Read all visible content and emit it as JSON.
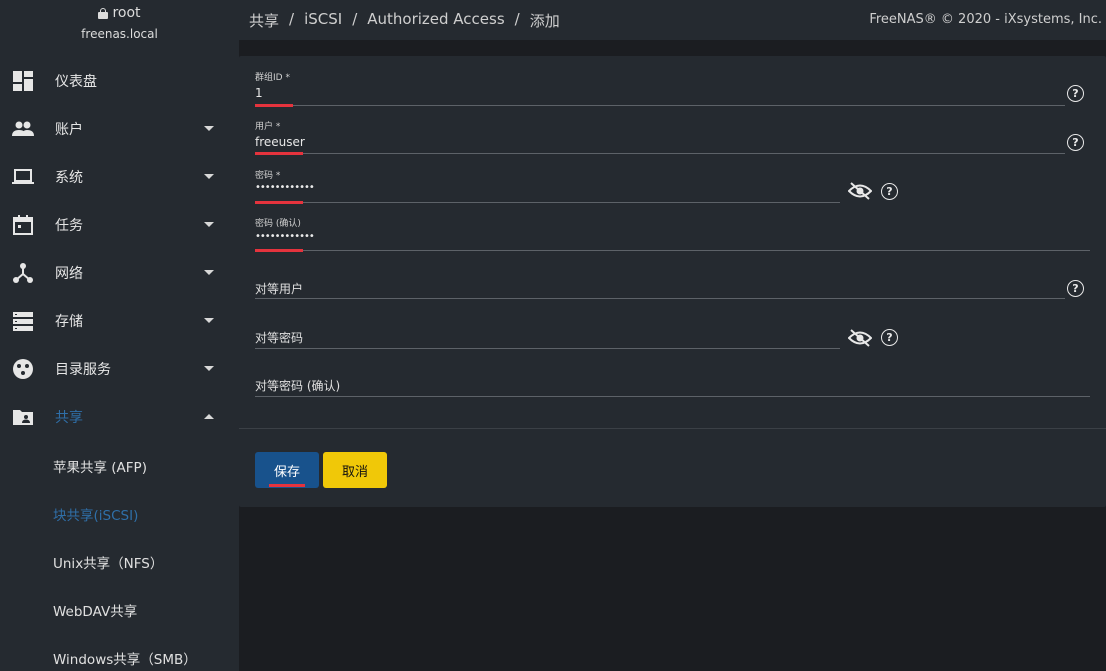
{
  "user": {
    "name": "root",
    "host": "freenas.local"
  },
  "sidebar": {
    "items": [
      {
        "label": "仪表盘",
        "icon": "dashboard-icon",
        "expandable": false
      },
      {
        "label": "账户",
        "icon": "people-icon",
        "expandable": true
      },
      {
        "label": "系统",
        "icon": "laptop-icon",
        "expandable": true
      },
      {
        "label": "任务",
        "icon": "calendar-icon",
        "expandable": true
      },
      {
        "label": "网络",
        "icon": "network-icon",
        "expandable": true
      },
      {
        "label": "存储",
        "icon": "storage-icon",
        "expandable": true
      },
      {
        "label": "目录服务",
        "icon": "directory-icon",
        "expandable": true
      },
      {
        "label": "共享",
        "icon": "folder-shared-icon",
        "expandable": true,
        "expanded": true,
        "active": true
      }
    ],
    "sub_items": [
      {
        "label": "苹果共享 (AFP)"
      },
      {
        "label": "块共享(iSCSI)",
        "active": true
      },
      {
        "label": "Unix共享（NFS）"
      },
      {
        "label": "WebDAV共享"
      },
      {
        "label": "Windows共享（SMB）"
      }
    ]
  },
  "breadcrumb": [
    "共享",
    "iSCSI",
    "Authorized Access",
    "添加"
  ],
  "copyright": "FreeNAS® © 2020 - iXsystems, Inc.",
  "form": {
    "group_id": {
      "label": "群组ID *",
      "value": "1"
    },
    "user": {
      "label": "用户 *",
      "value": "freeuser"
    },
    "secret": {
      "label": "密码 *",
      "value": "••••••••••••"
    },
    "secret_confirm": {
      "label": "密码 (确认)",
      "value": "••••••••••••"
    },
    "peer_user": {
      "placeholder": "对等用户"
    },
    "peer_secret": {
      "placeholder": "对等密码"
    },
    "peer_secret_confirm": {
      "placeholder": "对等密码 (确认)"
    },
    "help_glyph": "?"
  },
  "buttons": {
    "save": "保存",
    "cancel": "取消"
  },
  "colors": {
    "accent_blue": "#18528c",
    "cancel_yellow": "#f0c808",
    "focus_red": "#e5333d",
    "active_text": "#2f6fa8"
  }
}
